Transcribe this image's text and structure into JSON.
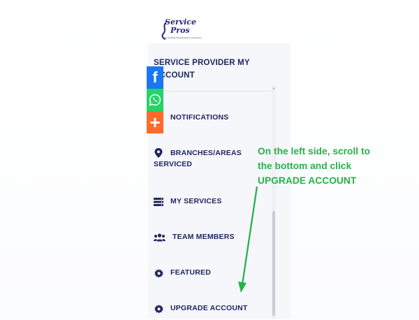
{
  "logo": {
    "line1": "Service",
    "line2": "Pros",
    "tagline": "Connecting Professionals to Customers"
  },
  "menu": {
    "title_line1": "SERVICE PROVIDER MY",
    "title_line2": "ACCOUNT",
    "items": [
      {
        "label": "NOTIFICATIONS",
        "icon": "bell-icon"
      },
      {
        "label_line1": "BRANCHES/AREAS",
        "label_line2": "SERVICED",
        "icon": "map-pin-icon"
      },
      {
        "label": "MY SERVICES",
        "icon": "server-list-icon"
      },
      {
        "label": "TEAM MEMBERS",
        "icon": "users-icon"
      },
      {
        "label": "FEATURED",
        "icon": "gear-icon"
      },
      {
        "label": "UPGRADE ACCOUNT",
        "icon": "gear-icon"
      }
    ]
  },
  "share": {
    "facebook": "f",
    "plus": "+"
  },
  "annotation": {
    "line1": "On the left side, scroll to",
    "line2": "the bottom and click",
    "line3": "UPGRADE ACCOUNT",
    "color": "#29b14a"
  },
  "colors": {
    "menu_text": "#1e2660",
    "facebook": "#1877f2",
    "whatsapp": "#25d366",
    "share_plus": "#ff6a2b"
  }
}
